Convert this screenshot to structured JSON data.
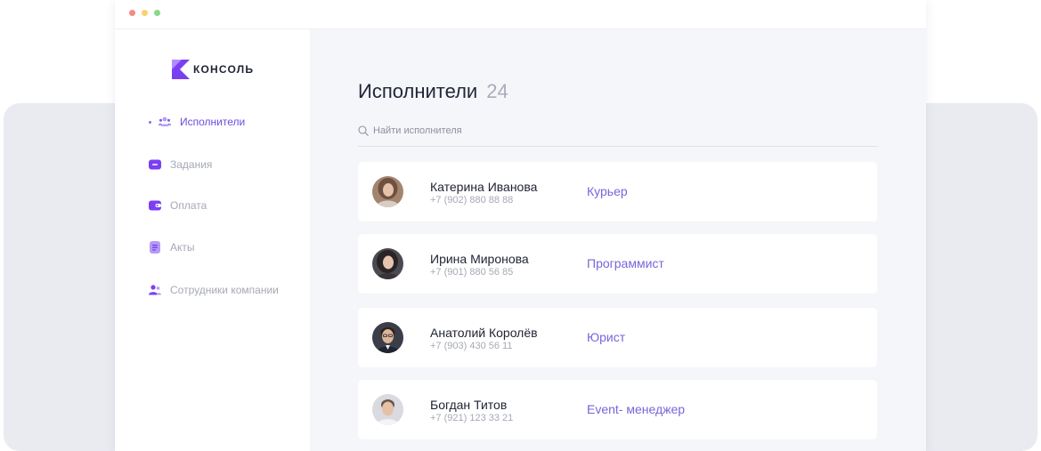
{
  "app": {
    "logo_text": "КОНСОЛЬ"
  },
  "sidebar": {
    "items": [
      {
        "label": "Исполнители",
        "icon": "users-icon",
        "active": true
      },
      {
        "label": "Задания",
        "icon": "folder-icon"
      },
      {
        "label": "Оплата",
        "icon": "wallet-icon"
      },
      {
        "label": "Акты",
        "icon": "document-icon"
      },
      {
        "label": "Сотрудники компании",
        "icon": "employees-icon"
      }
    ]
  },
  "main": {
    "title": "Исполнители",
    "count": "24",
    "search": {
      "placeholder": "Найти исполнителя"
    },
    "performers": [
      {
        "name": "Катерина Иванова",
        "phone": "+7 (902) 880 88 88",
        "role": "Курьер"
      },
      {
        "name": "Ирина Миронова",
        "phone": "+7 (901) 880 56 85",
        "role": "Программист"
      },
      {
        "name": "Анатолий Королёв",
        "phone": "+7 (903) 430 56 11",
        "role": "Юрист"
      },
      {
        "name": "Богдан Титов",
        "phone": "+7 (921) 123 33 21",
        "role": "Event- менеджер"
      }
    ]
  },
  "colors": {
    "accent": "#6d4ce0",
    "role_text": "#7a64dc",
    "muted": "#a6a9b6",
    "background_panel": "#e9ebf1"
  }
}
